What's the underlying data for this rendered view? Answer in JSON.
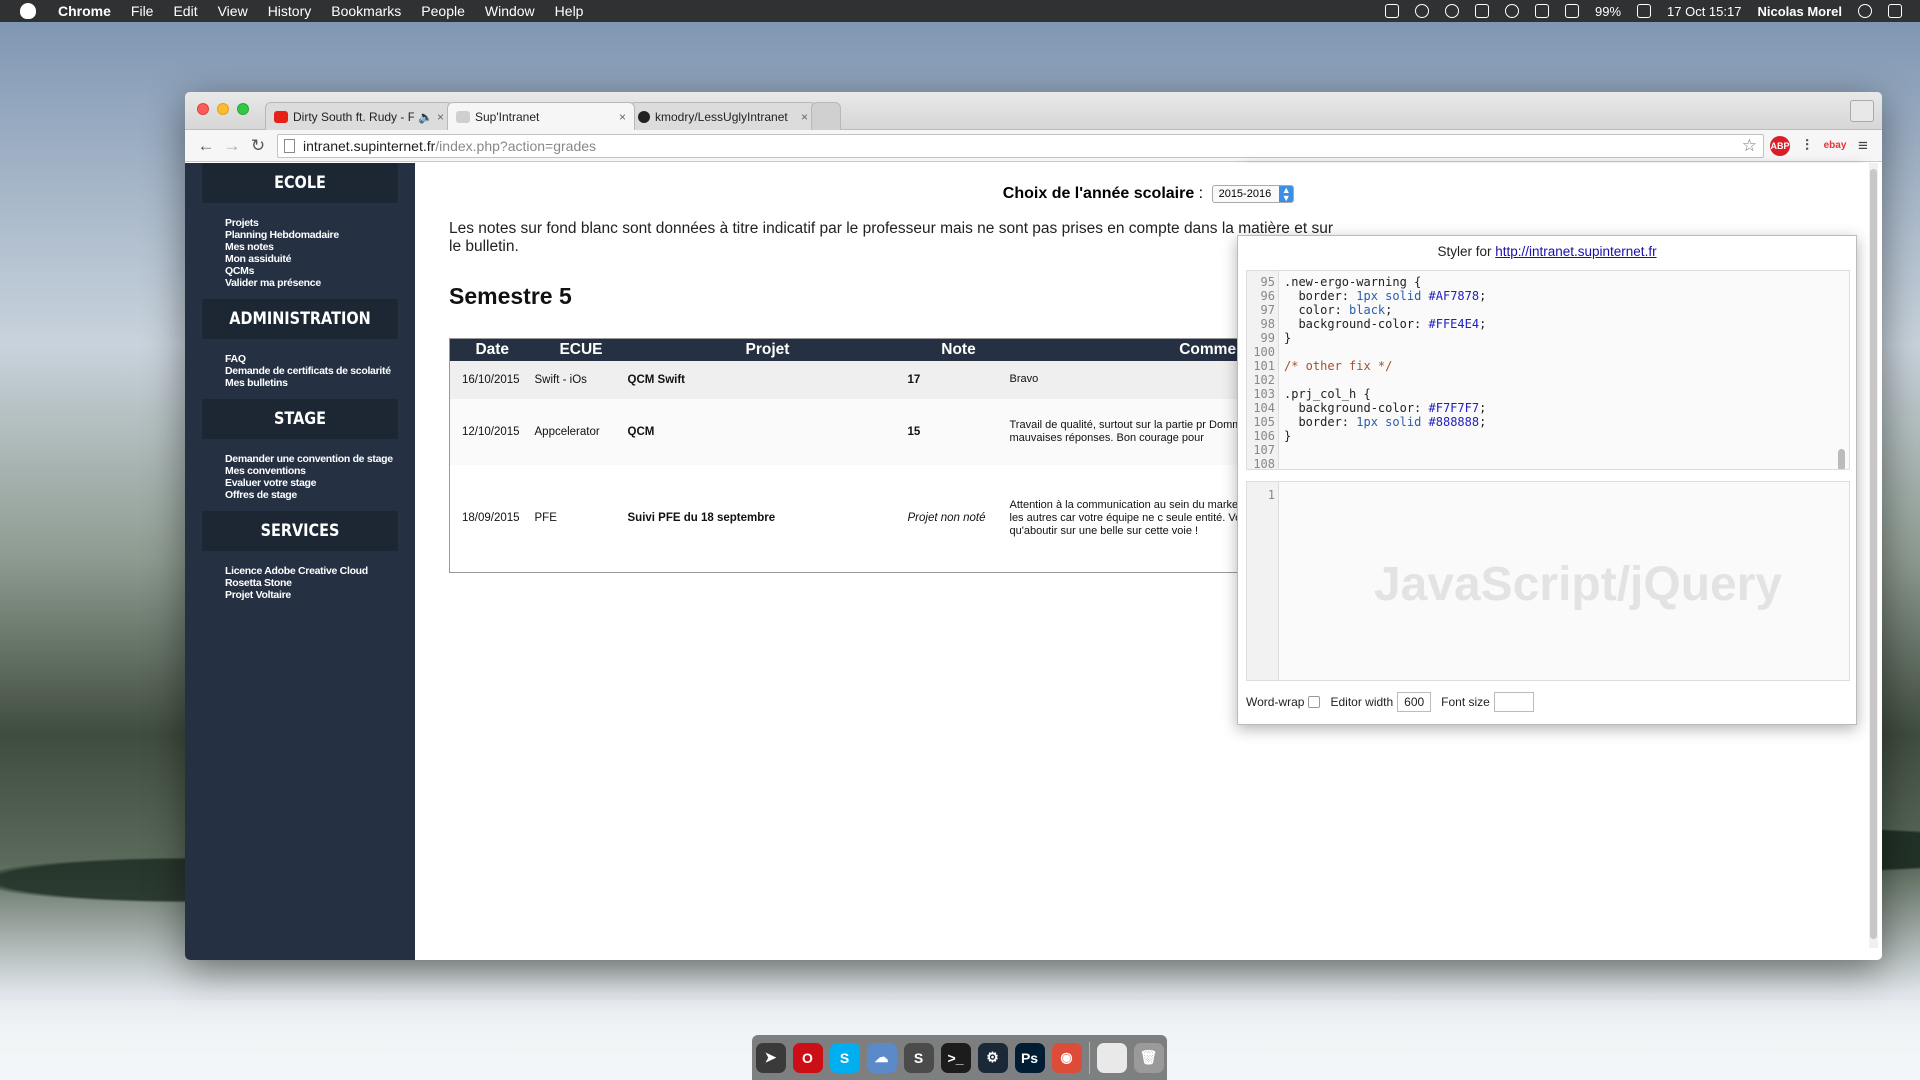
{
  "menubar": {
    "app": "Chrome",
    "items": [
      "File",
      "Edit",
      "View",
      "History",
      "Bookmarks",
      "People",
      "Window",
      "Help"
    ],
    "battery": "99%",
    "datetime": "17 Oct  15:17",
    "user": "Nicolas Morel"
  },
  "browser": {
    "tabs": [
      {
        "title": "Dirty South ft. Rudy - Fi",
        "favicon_color": "#e62117"
      },
      {
        "title": "Sup'Intranet",
        "favicon_color": "#cfcfcf"
      },
      {
        "title": "kmodry/LessUglyIntranet",
        "favicon_color": "#222222"
      }
    ],
    "url_host": "intranet.supinternet.fr",
    "url_path": "/index.php?action=grades",
    "extensions": {
      "abp": "ABP",
      "ebay": "ebay",
      "styler": "S"
    }
  },
  "sidebar": {
    "sections": [
      {
        "title": "ECOLE",
        "links": [
          "Projets",
          "Planning Hebdomadaire",
          "Mes notes",
          "Mon assiduité",
          "QCMs",
          "Valider ma présence"
        ]
      },
      {
        "title": "ADMINISTRATION",
        "links": [
          "FAQ",
          "Demande de certificats de scolarité",
          "Mes bulletins"
        ]
      },
      {
        "title": "STAGE",
        "links": [
          "Demander une convention de stage",
          "Mes conventions",
          "Evaluer votre stage",
          "Offres de stage"
        ]
      },
      {
        "title": "SERVICES",
        "links": [
          "Licence Adobe Creative Cloud",
          "Rosetta Stone",
          "Projet Voltaire"
        ]
      }
    ]
  },
  "main": {
    "year_label": "Choix de l'année scolaire",
    "year_value": "2015-2016",
    "notice": "Les notes sur fond blanc sont données à titre indicatif par le professeur mais ne sont pas prises en compte dans la matière et sur le bulletin.",
    "semester": "Semestre 5",
    "columns": [
      "Date",
      "ECUE",
      "Projet",
      "Note",
      "Commentaire"
    ],
    "rows": [
      {
        "date": "16/10/2015",
        "ecue": "Swift - iOs",
        "projet": "QCM Swift",
        "note": "17",
        "commentaire": "Bravo"
      },
      {
        "date": "12/10/2015",
        "ecue": "Appcelerator",
        "projet": "QCM",
        "note": "15",
        "commentaire": "Travail de qualité, surtout sur la partie pr Dommage que quelques questions de c mauvaises réponses. Bon courage pour"
      },
      {
        "date": "18/09/2015",
        "ecue": "PFE",
        "projet": "Suivi PFE du 18 septembre",
        "note": "Projet non noté",
        "commentaire": "Attention à la communication au sein du marketing ne doit pas prendre de décisi informer les autres car votre équipe ne c seule entité. Vous êtes organisés, rigour le projet ne peut qu'aboutir sur une belle sur cette voie !"
      }
    ]
  },
  "styler": {
    "title_prefix": "Styler for",
    "title_link": "http://intranet.supinternet.fr",
    "js_placeholder": "JavaScript/jQuery",
    "js_line": "1",
    "footer": {
      "wordwrap_label": "Word-wrap",
      "editor_width_label": "Editor width",
      "editor_width_value": "600",
      "font_size_label": "Font size",
      "font_size_value": ""
    },
    "code_lines": [
      {
        "n": "95",
        "text": ".new-ergo-warning {"
      },
      {
        "n": "96",
        "text": "  border: 1px solid #AF7878;"
      },
      {
        "n": "97",
        "text": "  color: black;"
      },
      {
        "n": "98",
        "text": "  background-color: #FFE4E4;"
      },
      {
        "n": "99",
        "text": "}"
      },
      {
        "n": "100",
        "text": ""
      },
      {
        "n": "101",
        "text": "/* other fix */"
      },
      {
        "n": "102",
        "text": ""
      },
      {
        "n": "103",
        "text": ".prj_col_h {"
      },
      {
        "n": "104",
        "text": "  background-color: #F7F7F7;"
      },
      {
        "n": "105",
        "text": "  border: 1px solid #888888;"
      },
      {
        "n": "106",
        "text": "}"
      },
      {
        "n": "107",
        "text": ""
      },
      {
        "n": "108",
        "text": ""
      }
    ]
  },
  "dock": {
    "icons": [
      {
        "name": "airmail-icon",
        "color": "#3a3a3a",
        "glyph": "➤"
      },
      {
        "name": "opera-icon",
        "color": "#cc0f16",
        "glyph": "O"
      },
      {
        "name": "skype-icon",
        "color": "#00aff0",
        "glyph": "S"
      },
      {
        "name": "cyberduck-icon",
        "color": "#5a8ac8",
        "glyph": "☁"
      },
      {
        "name": "sublime-icon",
        "color": "#4b4b4b",
        "glyph": "S"
      },
      {
        "name": "terminal-icon",
        "color": "#1c1c1c",
        "glyph": ">_"
      },
      {
        "name": "steam-icon",
        "color": "#1b2838",
        "glyph": "⚙"
      },
      {
        "name": "photoshop-icon",
        "color": "#001d34",
        "glyph": "Ps"
      },
      {
        "name": "chrome-icon",
        "color": "#dd4b39",
        "glyph": "◉"
      },
      {
        "name": "document-icon",
        "color": "#e9e9e9",
        "glyph": ""
      },
      {
        "name": "trash-icon",
        "color": "#9a9a9a",
        "glyph": "🗑"
      }
    ]
  }
}
